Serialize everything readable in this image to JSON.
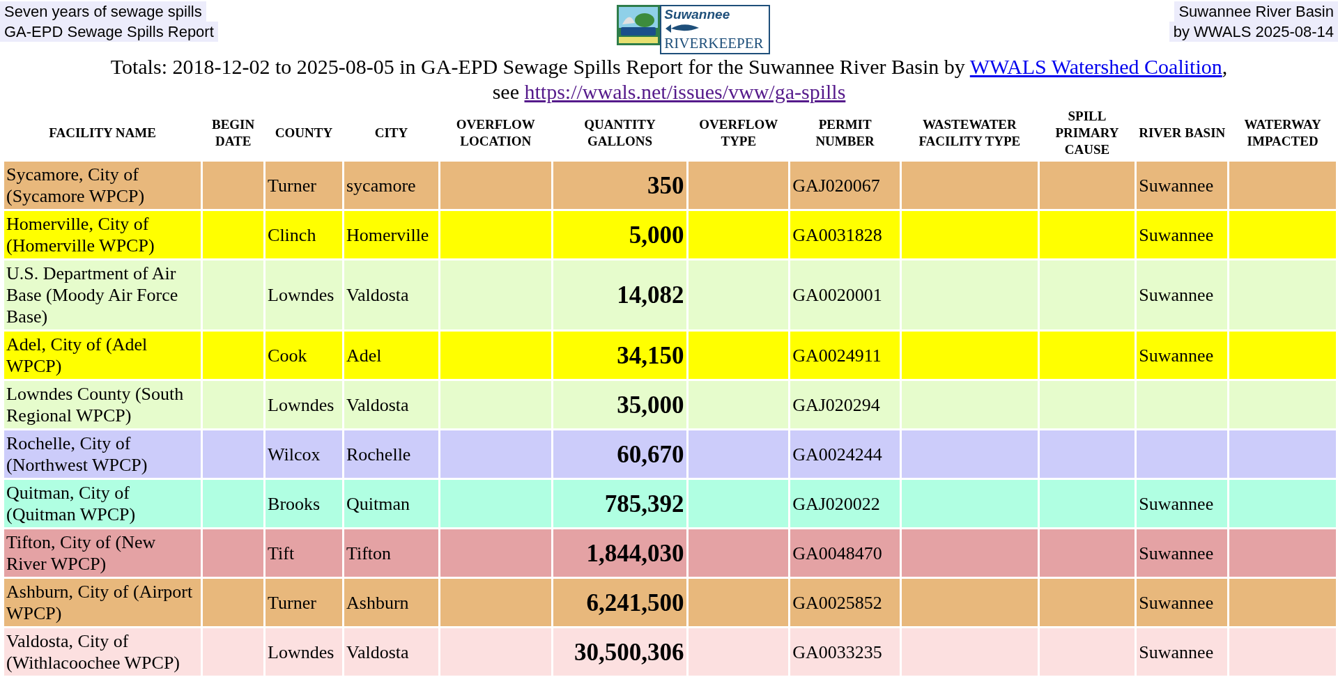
{
  "header": {
    "left_lines": [
      "Seven years of sewage spills",
      "GA-EPD Sewage Spills Report"
    ],
    "logo": {
      "line1": "Suwannee",
      "line2": "RIVERKEEPER"
    },
    "right_lines": [
      "Suwannee River Basin",
      "by WWALS 2025-08-14"
    ]
  },
  "title": {
    "text": "Totals: 2018-12-02 to 2025-08-05 in GA-EPD Sewage Spills Report for the Suwannee River Basin by ",
    "link": {
      "text": "WWALS Watershed Coalition",
      "visited": false
    },
    "after": ",",
    "see": "see ",
    "url": {
      "text": "https://wwals.net/issues/vww/ga-spills",
      "visited": true
    }
  },
  "table": {
    "columns": [
      "FACILITY NAME",
      "BEGIN DATE",
      "COUNTY",
      "CITY",
      "OVERFLOW LOCATION",
      "QUANTITY GALLONS",
      "OVERFLOW TYPE",
      "PERMIT NUMBER",
      "WASTEWATER FACILITY TYPE",
      "SPILL PRIMARY CAUSE",
      "RIVER BASIN",
      "WATERWAY IMPACTED"
    ],
    "rows": [
      {
        "facility": "Sycamore, City of (Sycamore WPCP)",
        "county": "Turner",
        "city": "sycamore",
        "quantity": "350",
        "permit": "GAJ020067",
        "river_basin": "Suwannee",
        "color": "#e8b87c"
      },
      {
        "facility": "Homerville, City of (Homerville WPCP)",
        "county": "Clinch",
        "city": "Homerville",
        "quantity": "5,000",
        "permit": "GA0031828",
        "river_basin": "Suwannee",
        "color": "#ffff00"
      },
      {
        "facility": "U.S. Department of Air Base (Moody Air Force Base)",
        "county": "Lowndes",
        "city": "Valdosta",
        "quantity": "14,082",
        "permit": "GA0020001",
        "river_basin": "Suwannee",
        "color": "#e6fccc"
      },
      {
        "facility": "Adel, City of (Adel WPCP)",
        "county": "Cook",
        "city": "Adel",
        "quantity": "34,150",
        "permit": "GA0024911",
        "river_basin": "Suwannee",
        "color": "#ffff00"
      },
      {
        "facility": "Lowndes County (South Regional WPCP)",
        "county": "Lowndes",
        "city": "Valdosta",
        "quantity": "35,000",
        "permit": "GAJ020294",
        "color": "#e6fccc"
      },
      {
        "facility": "Rochelle, City of (Northwest WPCP)",
        "county": "Wilcox",
        "city": "Rochelle",
        "quantity": "60,670",
        "permit": "GA0024244",
        "color": "#ccccfa"
      },
      {
        "facility": "Quitman, City of (Quitman WPCP)",
        "county": "Brooks",
        "city": "Quitman",
        "quantity": "785,392",
        "permit": "GAJ020022",
        "river_basin": "Suwannee",
        "color": "#b0ffe2"
      },
      {
        "facility": "Tifton, City of (New River WPCP)",
        "county": "Tift",
        "city": "Tifton",
        "quantity": "1,844,030",
        "permit": "GA0048470",
        "river_basin": "Suwannee",
        "color": "#e4a2a4"
      },
      {
        "facility": "Ashburn, City of (Airport WPCP)",
        "county": "Turner",
        "city": "Ashburn",
        "quantity": "6,241,500",
        "permit": "GA0025852",
        "river_basin": "Suwannee",
        "color": "#e8b87c"
      },
      {
        "facility": "Valdosta, City of (Withlacoochee WPCP)",
        "county": "Lowndes",
        "city": "Valdosta",
        "quantity": "30,500,306",
        "permit": "GA0033235",
        "river_basin": "Suwannee",
        "color": "#fce0e0"
      }
    ]
  }
}
